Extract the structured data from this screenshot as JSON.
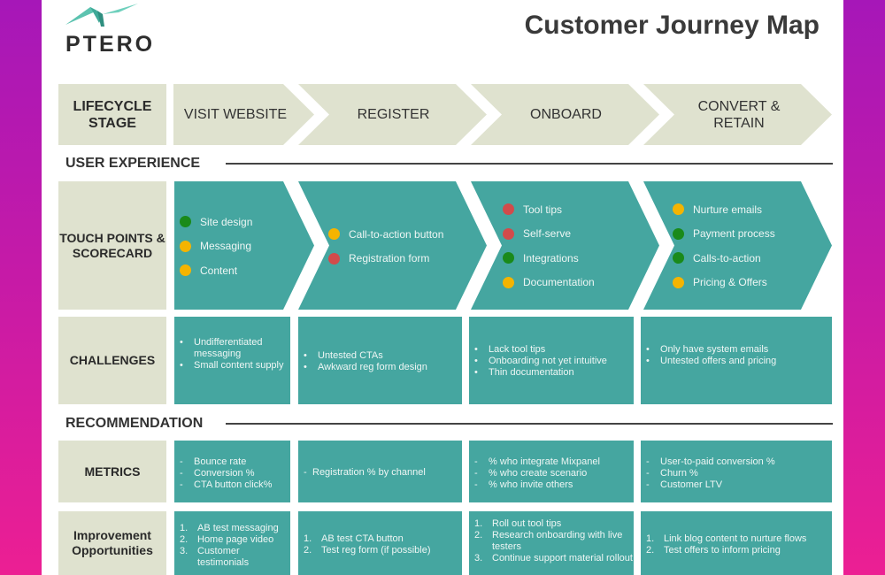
{
  "brand": {
    "logo_text": "PTERO",
    "logo_icon": "pterodactyl-bird-icon"
  },
  "title": "Customer Journey Map",
  "colors": {
    "teal": "#45a6a0",
    "beige": "#dfe2cf",
    "green": "#1a8a1a",
    "yellow": "#f4b400",
    "red": "#d24b4b",
    "background_top": "#a617b8",
    "background_bottom": "#ec1f93"
  },
  "lifecycle": {
    "label": "LIFECYCLE STAGE",
    "stages": [
      "VISIT WEBSITE",
      "REGISTER",
      "ONBOARD",
      "CONVERT & RETAIN"
    ]
  },
  "sections": {
    "user_experience": "USER EXPERIENCE",
    "recommendation": "RECOMMENDATION"
  },
  "touch_points": {
    "label": "TOUCH POINTS & SCORECARD",
    "stages": [
      {
        "items": [
          {
            "text": "Site design",
            "status": "green"
          },
          {
            "text": "Messaging",
            "status": "yellow"
          },
          {
            "text": "Content",
            "status": "yellow"
          }
        ]
      },
      {
        "items": [
          {
            "text": "Call-to-action button",
            "status": "yellow"
          },
          {
            "text": "Registration form",
            "status": "red"
          }
        ]
      },
      {
        "items": [
          {
            "text": "Tool tips",
            "status": "red"
          },
          {
            "text": "Self-serve",
            "status": "red"
          },
          {
            "text": "Integrations",
            "status": "green"
          },
          {
            "text": "Documentation",
            "status": "yellow"
          }
        ]
      },
      {
        "items": [
          {
            "text": "Nurture emails",
            "status": "yellow"
          },
          {
            "text": "Payment process",
            "status": "green"
          },
          {
            "text": "Calls-to-action",
            "status": "green"
          },
          {
            "text": "Pricing & Offers",
            "status": "yellow"
          }
        ]
      }
    ]
  },
  "challenges": {
    "label": "CHALLENGES",
    "stages": [
      [
        "Undifferentiated messaging",
        "Small content supply"
      ],
      [
        "Untested CTAs",
        "Awkward reg form design"
      ],
      [
        "Lack tool tips",
        "Onboarding not yet intuitive",
        "Thin documentation"
      ],
      [
        "Only have system emails",
        "Untested offers and pricing"
      ]
    ]
  },
  "metrics": {
    "label": "METRICS",
    "stages": [
      [
        "Bounce rate",
        "Conversion %",
        "CTA button click%"
      ],
      [
        "Registration % by channel"
      ],
      [
        "% who integrate Mixpanel",
        "% who create scenario",
        "% who invite others"
      ],
      [
        "User-to-paid conversion %",
        "Churn %",
        "Customer LTV"
      ]
    ]
  },
  "improvements": {
    "label": "Improvement Opportunities",
    "stages": [
      [
        "AB test messaging",
        "Home page video",
        "Customer testimonials"
      ],
      [
        "AB test CTA button",
        "Test reg form (if possible)"
      ],
      [
        "Roll out tool tips",
        "Research onboarding with live testers",
        "Continue support material rollout"
      ],
      [
        "Link blog content to nurture flows",
        "Test offers to inform pricing"
      ]
    ]
  }
}
